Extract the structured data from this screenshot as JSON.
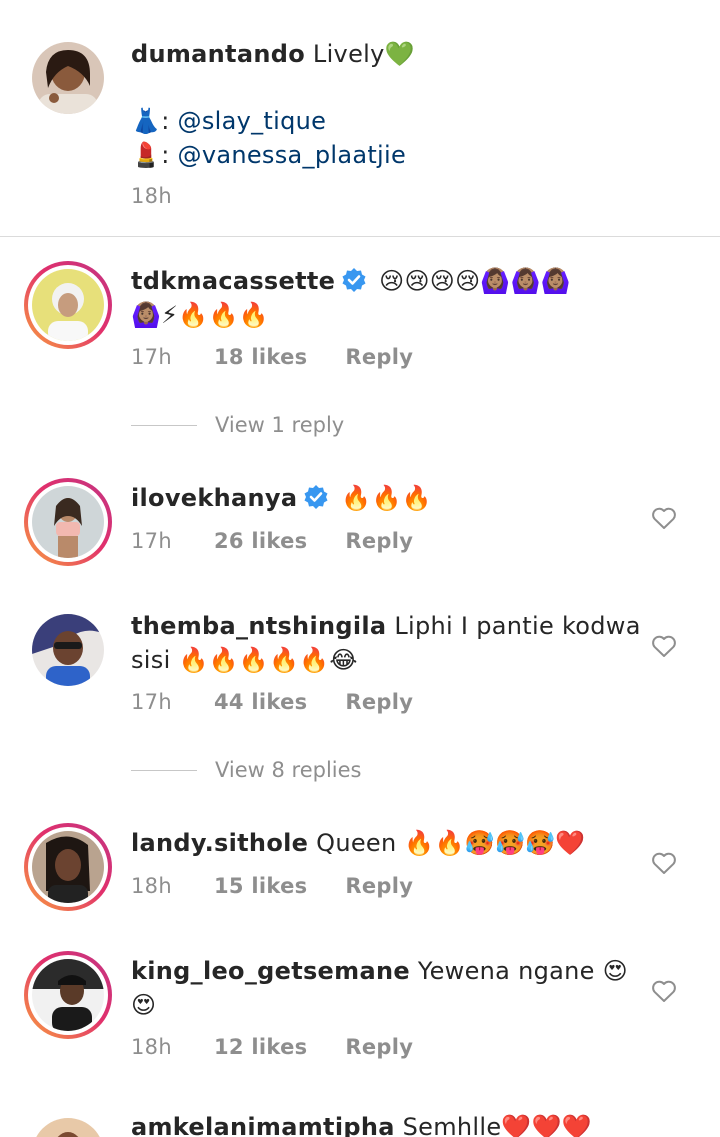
{
  "caption": {
    "username": "dumantando",
    "text": "Lively",
    "heart": "💚",
    "line1_emoji": "👗",
    "line1_mention": "@slay_tique",
    "line2_emoji": "💄",
    "line2_mention": "@vanessa_plaatjie",
    "time": "18h"
  },
  "comments": [
    {
      "username": "tdkmacassette",
      "verified": true,
      "text_line1": "😢😢😢😢🙆🏽‍♀️🙆🏽‍♀️🙆🏽‍♀️",
      "text_line2": "🙆🏽‍♀️⚡🔥🔥🔥",
      "time": "17h",
      "likes": "18 likes",
      "reply": "Reply",
      "view_replies": "View 1 reply"
    },
    {
      "username": "ilovekhanya",
      "verified": true,
      "text_line1": "🔥🔥🔥",
      "time": "17h",
      "likes": "26 likes",
      "reply": "Reply"
    },
    {
      "username": "themba_ntshingila",
      "text_line1": "Liphi I pantie kodwa",
      "text_line2": "sisi 🔥🔥🔥🔥🔥😂",
      "time": "17h",
      "likes": "44 likes",
      "reply": "Reply",
      "view_replies": "View 8 replies"
    },
    {
      "username": "landy.sithole",
      "text_line1": "Queen 🔥🔥🥵🥵🥵❤️",
      "time": "18h",
      "likes": "15 likes",
      "reply": "Reply"
    },
    {
      "username": "king_leo_getsemane",
      "text_line1": "Yewena ngane 😍",
      "text_line2": "😍",
      "time": "18h",
      "likes": "12 likes",
      "reply": "Reply"
    },
    {
      "username": "amkelanimamtipha",
      "text_line1": "Semhlle❤️❤️❤️"
    }
  ],
  "icons": {
    "heart": "heart-outline-icon",
    "verified": "verified-badge-icon"
  },
  "colors": {
    "mention": "#00376b",
    "meta": "#8e8e8e",
    "verified": "#3897f0"
  }
}
